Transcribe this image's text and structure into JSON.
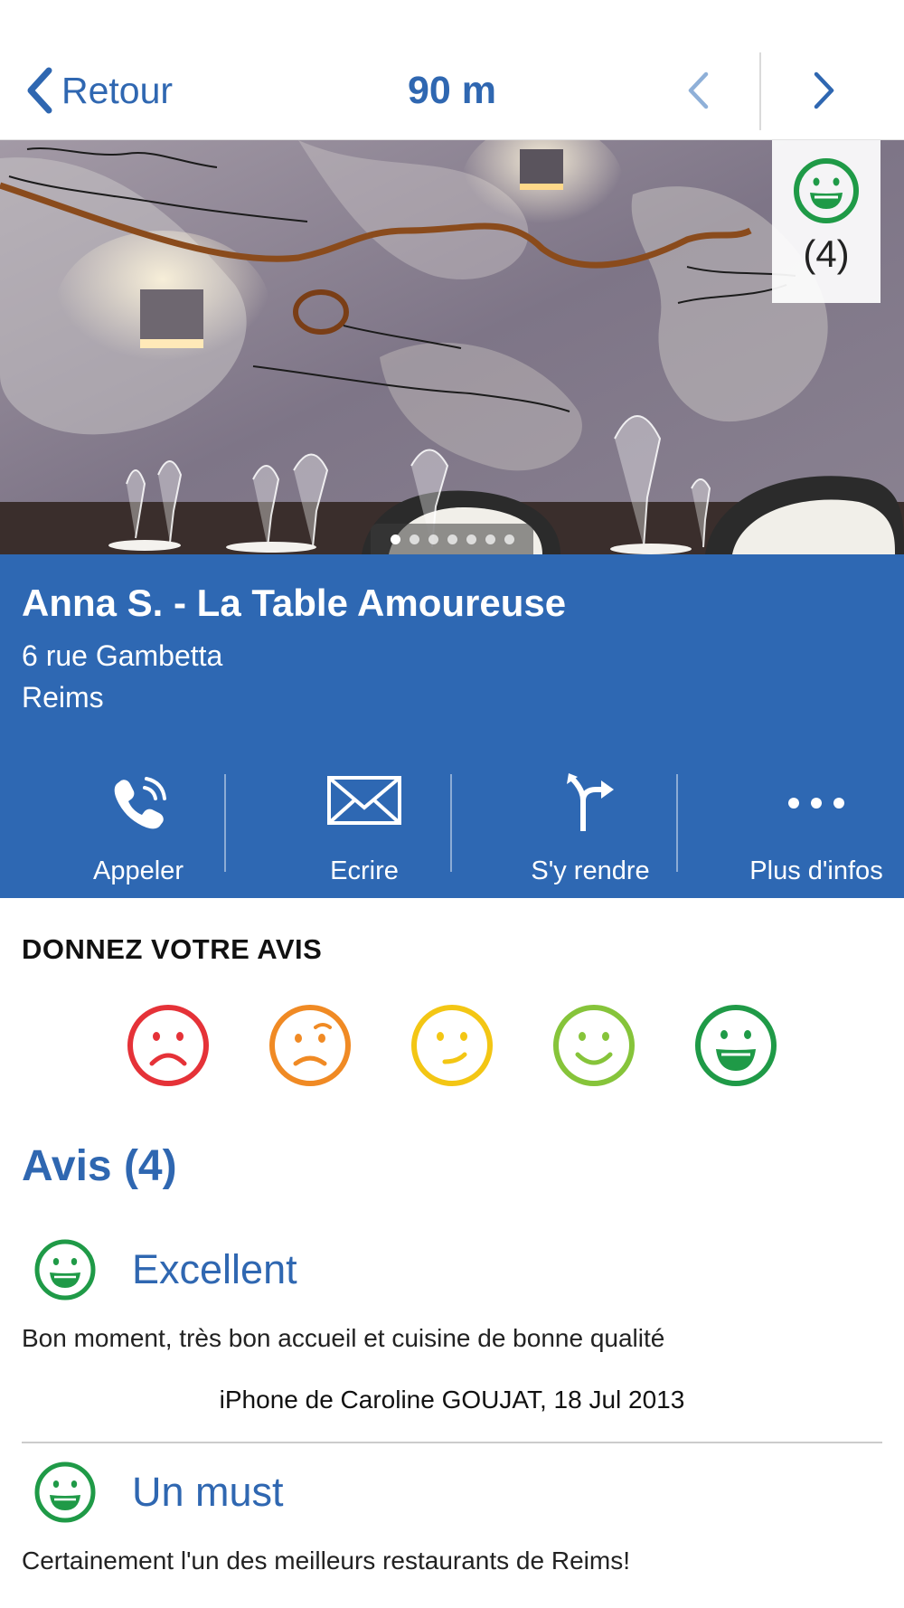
{
  "nav": {
    "back_label": "Retour",
    "distance": "90 m",
    "prev_icon": "chevron-left-icon",
    "next_icon": "chevron-right-icon"
  },
  "hero": {
    "rating_count": "(4)",
    "rating_icon": "very-happy-face-icon",
    "photo_dots": 7,
    "active_dot": 1
  },
  "restaurant": {
    "name": "Anna S. - La Table Amoureuse",
    "street": " 6 rue Gambetta",
    "city": "Reims"
  },
  "actions": [
    {
      "label": "Appeler",
      "icon": "phone-icon"
    },
    {
      "label": "Ecrire",
      "icon": "envelope-icon"
    },
    {
      "label": "S'y rendre",
      "icon": "directions-icon"
    },
    {
      "label": "Plus d'infos",
      "icon": "more-dots-icon"
    }
  ],
  "rate": {
    "title": "DONNEZ VOTRE AVIS",
    "faces": [
      {
        "icon": "very-sad-face-icon",
        "color": "#e53238"
      },
      {
        "icon": "sad-face-icon",
        "color": "#f08a24"
      },
      {
        "icon": "neutral-face-icon",
        "color": "#f3c614"
      },
      {
        "icon": "happy-face-icon",
        "color": "#86c43a"
      },
      {
        "icon": "very-happy-face-icon",
        "color": "#1f9a47"
      }
    ]
  },
  "reviews": {
    "title": "Avis (4)",
    "items": [
      {
        "title": "Excellent",
        "text": "Bon moment, très bon accueil et cuisine de bonne qualité",
        "author": "iPhone de Caroline GOUJAT, 18 Jul 2013"
      },
      {
        "title": "Un must",
        "text": "Certainement l'un des meilleurs restaurants de Reims!"
      }
    ]
  },
  "colors": {
    "brand_blue": "#2e68b3",
    "link_blue": "#2f67b1",
    "rating_green": "#1f9a47"
  }
}
